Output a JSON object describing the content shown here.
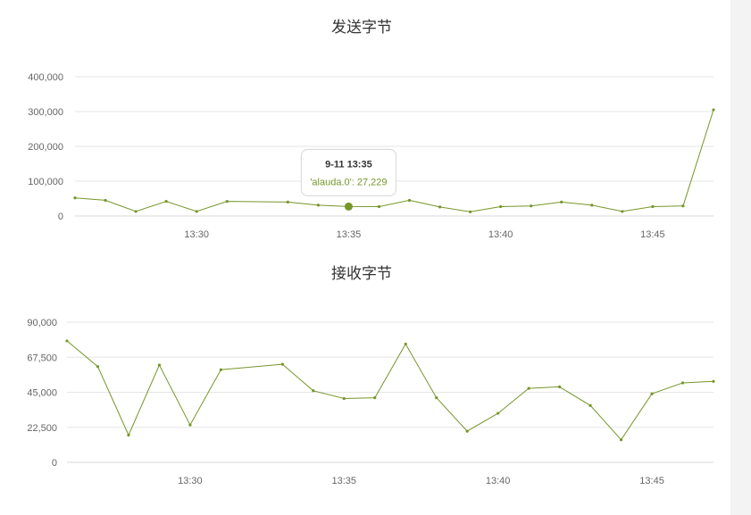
{
  "chart_data": [
    {
      "type": "line",
      "title": "发送字节",
      "xlabel": "",
      "ylabel": "",
      "ylim": [
        0,
        400000
      ],
      "yticks": [
        "0",
        "100,000",
        "200,000",
        "300,000",
        "400,000"
      ],
      "ytick_values": [
        0,
        100000,
        200000,
        300000,
        400000
      ],
      "xticks": [
        "13:30",
        "13:35",
        "13:40",
        "13:45"
      ],
      "xtick_values": [
        "13:30",
        "13:35",
        "13:40",
        "13:45"
      ],
      "grid": true,
      "series": [
        {
          "name": "alauda.0",
          "color": "#76962a",
          "x": [
            "13:26",
            "13:27",
            "13:28",
            "13:29",
            "13:30",
            "13:31",
            "13:33",
            "13:34",
            "13:35",
            "13:36",
            "13:37",
            "13:38",
            "13:39",
            "13:40",
            "13:41",
            "13:42",
            "13:43",
            "13:44",
            "13:45",
            "13:46",
            "13:47"
          ],
          "values": [
            52000,
            45000,
            13000,
            42000,
            13000,
            42000,
            40000,
            31000,
            27229,
            27000,
            45000,
            26000,
            12000,
            27000,
            29000,
            40000,
            31000,
            13000,
            27000,
            29000,
            305000
          ]
        }
      ],
      "tooltip": {
        "title": "9-11 13:35",
        "text": "'alauda.0': 27,229",
        "point_index": 8
      }
    },
    {
      "type": "line",
      "title": "接收字节",
      "xlabel": "",
      "ylabel": "",
      "ylim": [
        0,
        90000
      ],
      "yticks": [
        "0",
        "22,500",
        "45,000",
        "67,500",
        "90,000"
      ],
      "ytick_values": [
        0,
        22500,
        45000,
        67500,
        90000
      ],
      "xticks": [
        "13:30",
        "13:35",
        "13:40",
        "13:45"
      ],
      "xtick_values": [
        "13:30",
        "13:35",
        "13:40",
        "13:45"
      ],
      "grid": true,
      "series": [
        {
          "name": "alauda.0",
          "color": "#76962a",
          "x": [
            "13:26",
            "13:27",
            "13:28",
            "13:29",
            "13:30",
            "13:31",
            "13:33",
            "13:34",
            "13:35",
            "13:36",
            "13:37",
            "13:38",
            "13:39",
            "13:40",
            "13:41",
            "13:42",
            "13:43",
            "13:44",
            "13:45",
            "13:46",
            "13:47"
          ],
          "values": [
            78000,
            61500,
            17500,
            62500,
            24000,
            59500,
            63000,
            46000,
            41000,
            41500,
            76000,
            41500,
            20000,
            31500,
            47500,
            48500,
            36500,
            14500,
            44000,
            51000,
            52000
          ]
        }
      ]
    }
  ]
}
